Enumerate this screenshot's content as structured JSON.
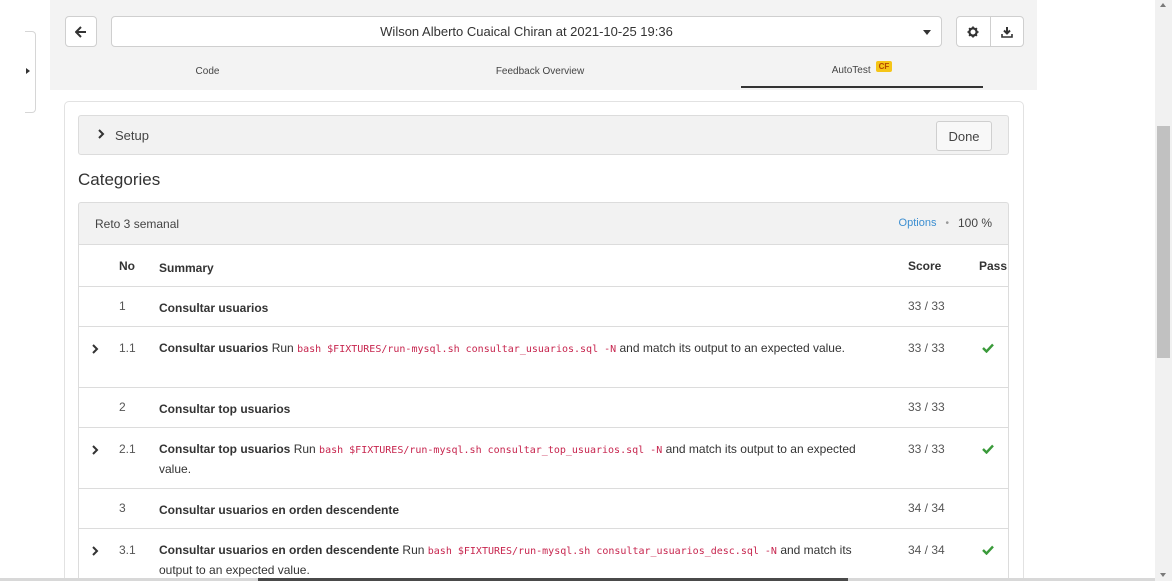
{
  "header": {
    "selected_submission": "Wilson Alberto Cuaical Chiran at 2021-10-25 19:36"
  },
  "icons": {
    "back": "arrow-left-icon",
    "settings": "gear-icon",
    "download": "download-icon",
    "sidebar": "chevron-right-icon",
    "check": "check-icon"
  },
  "tabs": [
    {
      "label": "Code"
    },
    {
      "label": "Feedback Overview"
    },
    {
      "label": "AutoTest",
      "badge": "CF",
      "active": true
    }
  ],
  "setup": {
    "label": "Setup",
    "done_label": "Done"
  },
  "categories_title": "Categories",
  "category": {
    "name": "Reto 3 semanal",
    "options_label": "Options",
    "score": "100 %"
  },
  "table": {
    "headers": {
      "no": "No",
      "summary": "Summary",
      "score": "Score",
      "pass": "Pass"
    },
    "rows": [
      {
        "no": "1",
        "title": "Consultar usuarios",
        "score": "33 / 33"
      },
      {
        "no": "1.1",
        "title": "Consultar usuarios",
        "run": "Run",
        "command": "bash $FIXTURES/run-mysql.sh consultar_usuarios.sql -N",
        "suffix": "and match its output to an expected value.",
        "score": "33 / 33",
        "passed": true
      },
      {
        "no": "2",
        "title": "Consultar top usuarios",
        "score": "33 / 33"
      },
      {
        "no": "2.1",
        "title": "Consultar top usuarios",
        "run": "Run",
        "command": "bash $FIXTURES/run-mysql.sh consultar_top_usuarios.sql -N",
        "suffix": "and match its output to an expected value.",
        "score": "33 / 33",
        "passed": true
      },
      {
        "no": "3",
        "title": "Consultar usuarios en orden descendente",
        "score": "34 / 34"
      },
      {
        "no": "3.1",
        "title": "Consultar usuarios en orden descendente",
        "run": "Run",
        "command": "bash $FIXTURES/run-mysql.sh consultar_usuarios_desc.sql -N",
        "suffix": "and match its output to an expected value.",
        "score": "34 / 34",
        "passed": true
      }
    ]
  },
  "colors": {
    "accent_link": "#3d8fd1",
    "pass_green": "#3a9a3a",
    "code_pink": "#c7254e",
    "badge_yellow": "#f5c518"
  }
}
